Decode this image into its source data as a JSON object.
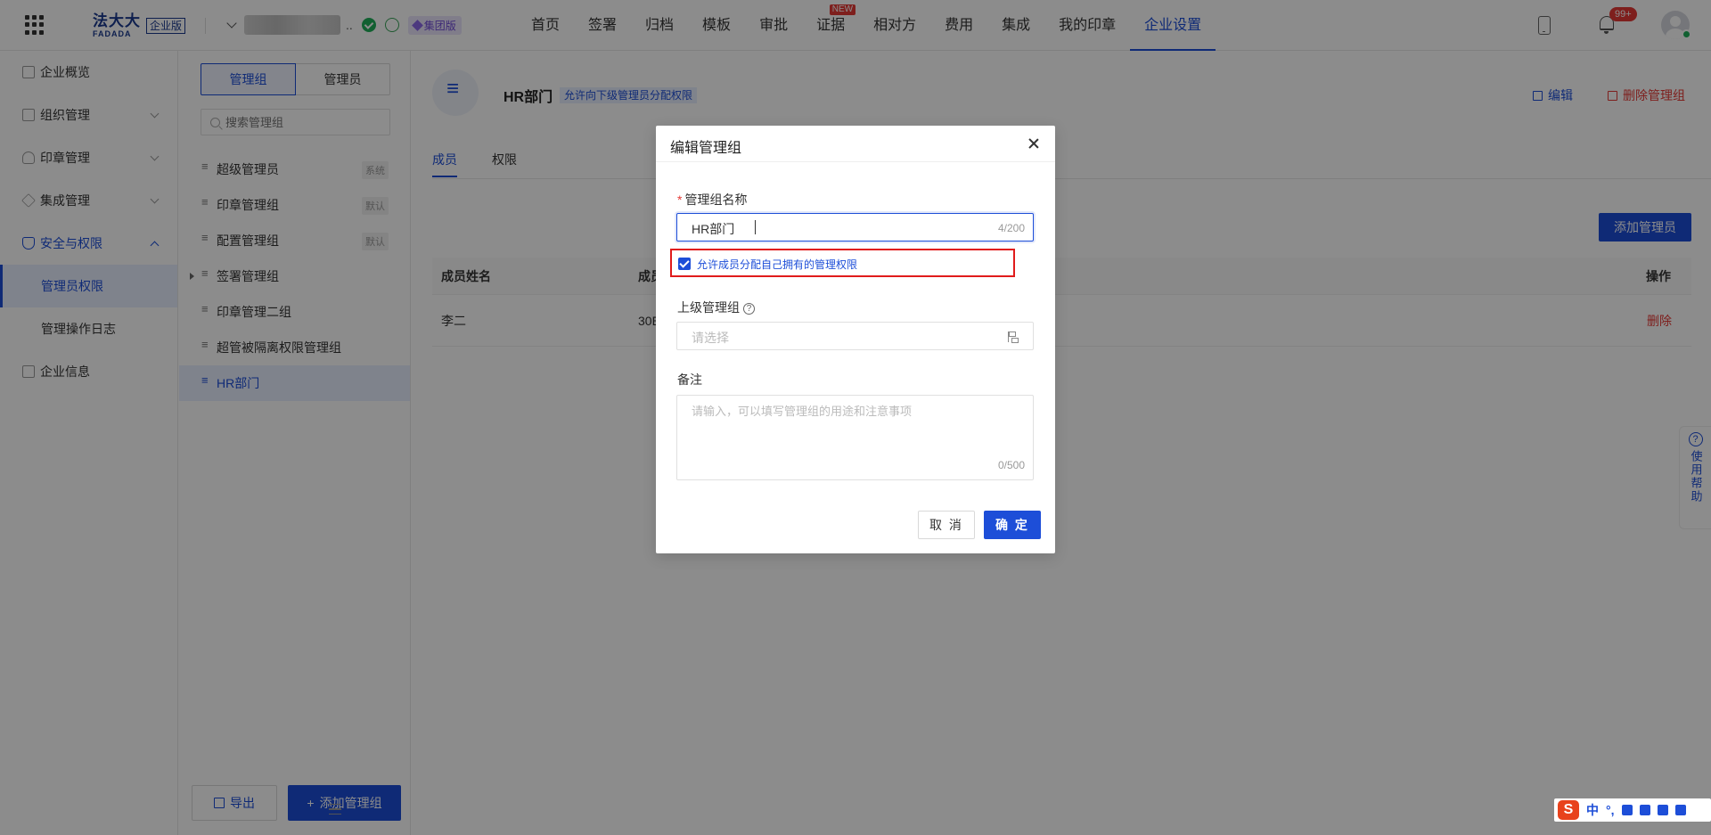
{
  "topbar": {
    "logo_cn": "法大大",
    "logo_en": "FADADA",
    "logo_badge": "企业版",
    "company_suffix": "..",
    "group_badge": "集团版",
    "nav": [
      {
        "label": "首页",
        "active": false
      },
      {
        "label": "签署",
        "active": false
      },
      {
        "label": "归档",
        "active": false
      },
      {
        "label": "模板",
        "active": false
      },
      {
        "label": "审批",
        "active": false
      },
      {
        "label": "证据",
        "active": false,
        "new": "NEW"
      },
      {
        "label": "相对方",
        "active": false
      },
      {
        "label": "费用",
        "active": false
      },
      {
        "label": "集成",
        "active": false
      },
      {
        "label": "我的印章",
        "active": false
      },
      {
        "label": "企业设置",
        "active": true
      }
    ],
    "notif_count": "99+",
    "accent": "#1d4ed8"
  },
  "sidebar": {
    "items": [
      {
        "label": "企业概览",
        "icon": "overview-icon"
      },
      {
        "label": "组织管理",
        "icon": "org-icon"
      },
      {
        "label": "印章管理",
        "icon": "seal-icon"
      },
      {
        "label": "集成管理",
        "icon": "layers-icon"
      },
      {
        "label": "安全与权限",
        "icon": "shield-icon"
      },
      {
        "label": "管理员权限"
      },
      {
        "label": "管理操作日志"
      },
      {
        "label": "企业信息",
        "icon": "info-icon"
      }
    ]
  },
  "groups": {
    "seg_groups": "管理组",
    "seg_admins": "管理员",
    "search_placeholder": "搜索管理组",
    "list": [
      {
        "label": "超级管理员",
        "tag": "系统"
      },
      {
        "label": "印章管理组",
        "tag": "默认"
      },
      {
        "label": "配置管理组",
        "tag": "默认"
      },
      {
        "label": "签署管理组"
      },
      {
        "label": "印章管理二组"
      },
      {
        "label": "超管被隔离权限管理组"
      },
      {
        "label": "HR部门"
      }
    ],
    "export_label": "导出",
    "add_label": "添加管理组"
  },
  "main": {
    "title": "HR部门",
    "tag": "允许向下级管理员分配权限",
    "edit_label": "编辑",
    "delete_label": "删除管理组",
    "tabs": [
      "成员",
      "权限"
    ],
    "add_admin_label": "添加管理员",
    "columns": [
      "成员姓名",
      "成员",
      "操作"
    ],
    "rows": [
      {
        "name": "李二",
        "member": "30E",
        "action": "删除"
      }
    ]
  },
  "help": {
    "label": "使用帮助"
  },
  "modal": {
    "title": "编辑管理组",
    "name_label": "管理组名称",
    "name_value": "HR部门",
    "name_count": "4/200",
    "checkbox_label": "允许成员分配自己拥有的管理权限",
    "checkbox_checked": true,
    "parent_label": "上级管理组",
    "parent_placeholder": "请选择",
    "remark_label": "备注",
    "remark_placeholder": "请输入，可以填写管理组的用途和注意事项",
    "remark_count": "0/500",
    "cancel_label": "取 消",
    "ok_label": "确 定"
  },
  "ime": {
    "mode": "中",
    "punct": "°,"
  }
}
